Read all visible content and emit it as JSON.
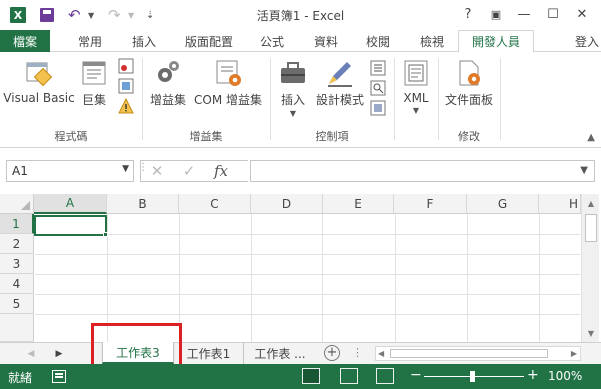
{
  "title_bar": {
    "logo_text": "X",
    "title": "活頁簿1 - Excel",
    "help": "?",
    "restore_ribbon": "▣",
    "minimize": "—",
    "maximize": "☐",
    "close": "✕"
  },
  "tabs": {
    "file": "檔案",
    "items": [
      "常用",
      "插入",
      "版面配置",
      "公式",
      "資料",
      "校閱",
      "檢視",
      "開發人員"
    ],
    "active": "開發人員",
    "login": "登入"
  },
  "ribbon": {
    "groups": [
      {
        "label": "程式碼",
        "buttons": [
          "Visual Basic",
          "巨集"
        ]
      },
      {
        "label": "增益集",
        "buttons": [
          "增益集",
          "COM 增益集"
        ]
      },
      {
        "label": "控制項",
        "buttons": [
          "插入",
          "設計模式"
        ]
      },
      {
        "label": "",
        "buttons": [
          "XML"
        ]
      },
      {
        "label": "修改",
        "buttons": [
          "文件面板"
        ]
      }
    ]
  },
  "formula_bar": {
    "name_box": "A1",
    "fx": "fx",
    "formula": ""
  },
  "grid": {
    "columns": [
      "A",
      "B",
      "C",
      "D",
      "E",
      "F",
      "G",
      "H"
    ],
    "rows": [
      "1",
      "2",
      "3",
      "4",
      "5"
    ],
    "active_cell": "A1"
  },
  "sheets": {
    "tabs": [
      "工作表3",
      "工作表1",
      "工作表 ..."
    ],
    "active": "工作表3",
    "add": "+",
    "more": "⋮"
  },
  "status": {
    "ready": "就緒",
    "zoom": "100%",
    "zoom_minus": "−",
    "zoom_plus": "+"
  },
  "colors": {
    "accent": "#217346",
    "highlight": "#dd1f26"
  }
}
